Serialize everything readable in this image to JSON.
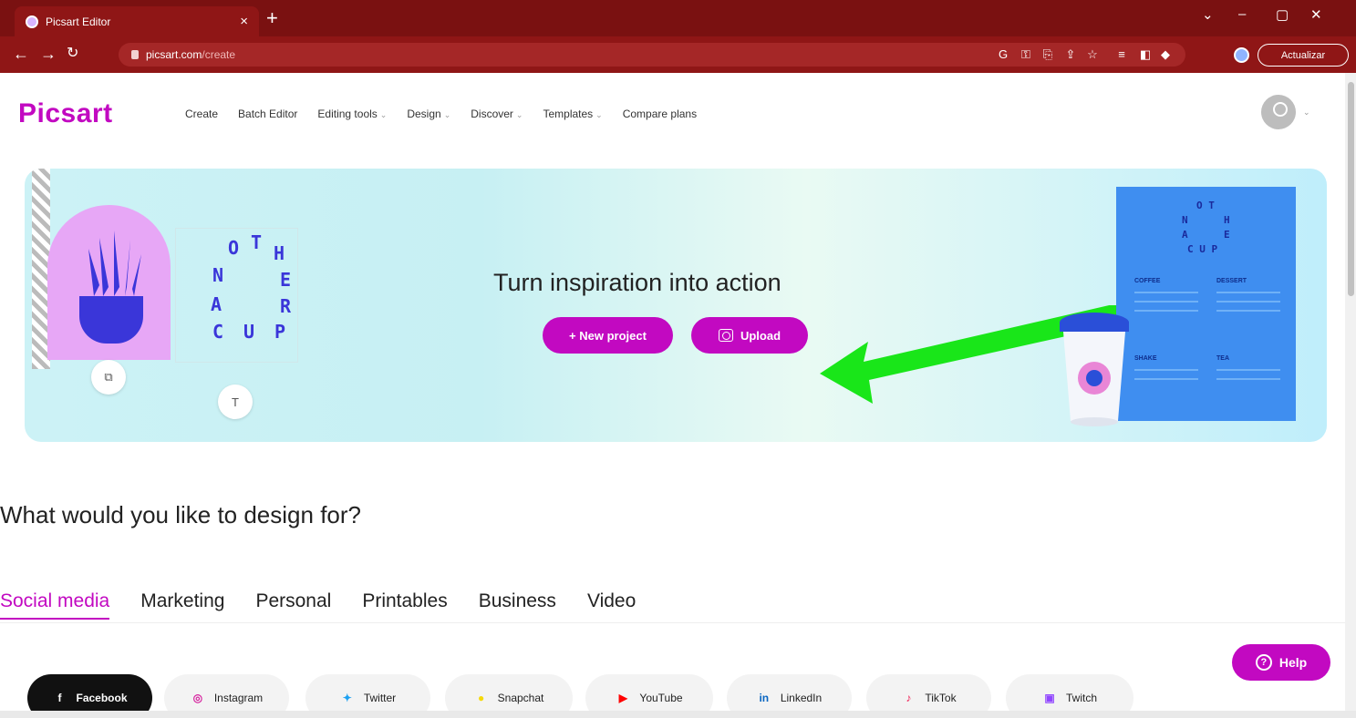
{
  "browser": {
    "tab_title": "Picsart Editor",
    "tab_close": "×",
    "new_tab": "+",
    "url_host": "picsart.com",
    "url_path": "/create",
    "update_label": "Actualizar",
    "window_controls": [
      "⌄",
      "–",
      "▢",
      "✕"
    ]
  },
  "nav": {
    "logo": "Picsart",
    "items": [
      {
        "label": "Create",
        "dropdown": false
      },
      {
        "label": "Batch Editor",
        "dropdown": false
      },
      {
        "label": "Editing tools",
        "dropdown": true
      },
      {
        "label": "Design",
        "dropdown": true
      },
      {
        "label": "Discover",
        "dropdown": true
      },
      {
        "label": "Templates",
        "dropdown": true
      },
      {
        "label": "Compare plans",
        "dropdown": false
      }
    ]
  },
  "banner": {
    "title": "Turn inspiration into action",
    "new_project_label": "+ New project",
    "upload_label": "Upload",
    "arrow_color": "#19e619",
    "menu_board": {
      "sections": [
        "COFFEE",
        "DESSERT",
        "SHAKE",
        "TEA"
      ]
    }
  },
  "section": {
    "heading": "What would you like to design for?",
    "tabs": [
      "Social media",
      "Marketing",
      "Personal",
      "Printables",
      "Business",
      "Video"
    ],
    "active_tab": "Social media",
    "chips": [
      {
        "label": "Facebook",
        "icon": "facebook-icon",
        "active": true
      },
      {
        "label": "Instagram",
        "icon": "instagram-icon",
        "active": false
      },
      {
        "label": "Twitter",
        "icon": "twitter-icon",
        "active": false
      },
      {
        "label": "Snapchat",
        "icon": "snapchat-icon",
        "active": false
      },
      {
        "label": "YouTube",
        "icon": "youtube-icon",
        "active": false
      },
      {
        "label": "LinkedIn",
        "icon": "linkedin-icon",
        "active": false
      },
      {
        "label": "TikTok",
        "icon": "tiktok-icon",
        "active": false
      },
      {
        "label": "Twitch",
        "icon": "twitch-icon",
        "active": false
      }
    ]
  },
  "help_label": "Help",
  "colors": {
    "brand": "#c209c1",
    "chrome": "#8f1616"
  }
}
